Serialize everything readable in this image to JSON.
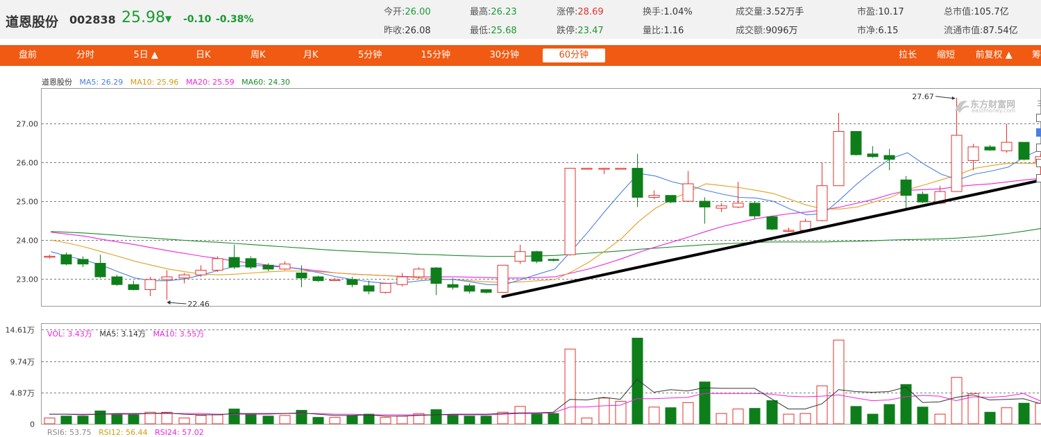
{
  "header": {
    "name": "道恩股份",
    "code": "002838",
    "price": "25.98",
    "arrow": "▼",
    "change": "-0.10",
    "change_pct": "-0.38%",
    "stats": [
      {
        "label": "今开:",
        "value": "26.00",
        "color": "green"
      },
      {
        "label": "最高:",
        "value": "26.23",
        "color": "green"
      },
      {
        "label": "涨停:",
        "value": "28.69",
        "color": "red"
      },
      {
        "label": "换手:",
        "value": "1.04%",
        "color": "plain"
      },
      {
        "label": "成交量:",
        "value": "3.52万手",
        "color": "plain"
      },
      {
        "label": "市盈:",
        "value": "10.17",
        "color": "plain"
      },
      {
        "label": "总市值:",
        "value": "105.7亿",
        "color": "plain"
      },
      {
        "label": "昨收:",
        "value": "26.08",
        "color": "plain"
      },
      {
        "label": "最低:",
        "value": "25.68",
        "color": "green"
      },
      {
        "label": "跌停:",
        "value": "23.47",
        "color": "green"
      },
      {
        "label": "量比:",
        "value": "1.16",
        "color": "plain"
      },
      {
        "label": "成交额:",
        "value": "9096万",
        "color": "plain"
      },
      {
        "label": "市净:",
        "value": "6.15",
        "color": "plain"
      },
      {
        "label": "流通市值:",
        "value": "87.54亿",
        "color": "plain"
      }
    ]
  },
  "nav": {
    "left": [
      "盘前",
      "分时",
      "5日 ▲",
      "日K",
      "周K",
      "月K",
      "5分钟",
      "15分钟",
      "30分钟",
      "60分钟"
    ],
    "active": "60分钟",
    "right": [
      "拉长",
      "缩短",
      "前复权 ▲",
      "筹"
    ]
  },
  "legend_main": {
    "name": "道恩股份",
    "ma5": "MA5: 26.29",
    "ma10": "MA10: 25.96",
    "ma20": "MA20: 25.59",
    "ma60": "MA60: 24.30"
  },
  "legend_vol": {
    "vol": "VOL: 3.43万",
    "ma5": "MA5: 3.14万",
    "ma10": "MA10: 3.55万"
  },
  "legend_rsi": {
    "rsi6": "RSI6: 53.75",
    "rsi12": "RSI12: 56.44",
    "rsi24": "RSI24: 57.02"
  },
  "annotations": {
    "high": "27.67",
    "low": "22.46"
  },
  "logo": {
    "cn": "东方财富网",
    "en": "eastmoney.com"
  },
  "colors": {
    "up": "#e5302a",
    "down": "#0e7e1a",
    "ma5": "#4a7fe0",
    "ma10": "#e0a020",
    "ma20": "#ee22dd",
    "ma60": "#1a8a2a",
    "accent": "#f05a12",
    "trend": "#000000"
  },
  "chart_data": [
    {
      "type": "candlestick",
      "title": "",
      "ylim": [
        22.3,
        27.9
      ],
      "yticks": [
        "23.00",
        "24.00",
        "25.00",
        "26.00",
        "27.00"
      ],
      "grid": true,
      "candles": [
        {
          "o": 23.58,
          "h": 23.62,
          "l": 23.52,
          "c": 23.58
        },
        {
          "o": 23.62,
          "h": 23.68,
          "l": 23.35,
          "c": 23.38
        },
        {
          "o": 23.5,
          "h": 23.58,
          "l": 23.3,
          "c": 23.38
        },
        {
          "o": 23.4,
          "h": 23.62,
          "l": 23.02,
          "c": 23.05
        },
        {
          "o": 23.05,
          "h": 23.1,
          "l": 22.82,
          "c": 22.85
        },
        {
          "o": 22.85,
          "h": 22.95,
          "l": 22.7,
          "c": 22.72
        },
        {
          "o": 22.72,
          "h": 23.05,
          "l": 22.55,
          "c": 22.98
        },
        {
          "o": 22.98,
          "h": 23.22,
          "l": 22.46,
          "c": 23.05
        },
        {
          "o": 23.02,
          "h": 23.15,
          "l": 22.88,
          "c": 23.1
        },
        {
          "o": 23.1,
          "h": 23.35,
          "l": 23.05,
          "c": 23.22
        },
        {
          "o": 23.22,
          "h": 23.58,
          "l": 23.18,
          "c": 23.52
        },
        {
          "o": 23.55,
          "h": 23.88,
          "l": 23.25,
          "c": 23.3
        },
        {
          "o": 23.52,
          "h": 23.58,
          "l": 23.25,
          "c": 23.3
        },
        {
          "o": 23.35,
          "h": 23.4,
          "l": 23.2,
          "c": 23.25
        },
        {
          "o": 23.25,
          "h": 23.45,
          "l": 23.22,
          "c": 23.38
        },
        {
          "o": 23.15,
          "h": 23.35,
          "l": 22.78,
          "c": 23.02
        },
        {
          "o": 23.05,
          "h": 23.08,
          "l": 22.92,
          "c": 22.95
        },
        {
          "o": 22.98,
          "h": 23.02,
          "l": 22.95,
          "c": 22.98
        },
        {
          "o": 22.98,
          "h": 23.05,
          "l": 22.78,
          "c": 22.85
        },
        {
          "o": 22.82,
          "h": 22.95,
          "l": 22.6,
          "c": 22.68
        },
        {
          "o": 22.65,
          "h": 22.9,
          "l": 22.62,
          "c": 22.88
        },
        {
          "o": 22.85,
          "h": 23.15,
          "l": 22.8,
          "c": 23.05
        },
        {
          "o": 23.05,
          "h": 23.3,
          "l": 23.0,
          "c": 23.25
        },
        {
          "o": 23.28,
          "h": 23.3,
          "l": 22.58,
          "c": 22.88
        },
        {
          "o": 22.85,
          "h": 23.02,
          "l": 22.72,
          "c": 22.78
        },
        {
          "o": 22.82,
          "h": 22.88,
          "l": 22.62,
          "c": 22.68
        },
        {
          "o": 22.72,
          "h": 22.72,
          "l": 22.62,
          "c": 22.65
        },
        {
          "o": 22.65,
          "h": 23.35,
          "l": 22.65,
          "c": 23.35
        },
        {
          "o": 23.45,
          "h": 23.88,
          "l": 23.38,
          "c": 23.7
        },
        {
          "o": 23.7,
          "h": 23.72,
          "l": 23.4,
          "c": 23.45
        },
        {
          "o": 23.5,
          "h": 23.52,
          "l": 23.45,
          "c": 23.48
        },
        {
          "o": 23.62,
          "h": 25.85,
          "l": 23.6,
          "c": 25.85
        },
        {
          "o": 25.85,
          "h": 25.85,
          "l": 25.85,
          "c": 25.85
        },
        {
          "o": 25.85,
          "h": 25.85,
          "l": 25.7,
          "c": 25.85
        },
        {
          "o": 25.85,
          "h": 25.85,
          "l": 25.85,
          "c": 25.85
        },
        {
          "o": 25.85,
          "h": 26.22,
          "l": 24.85,
          "c": 25.1
        },
        {
          "o": 25.1,
          "h": 25.28,
          "l": 25.05,
          "c": 25.15
        },
        {
          "o": 25.15,
          "h": 25.15,
          "l": 24.95,
          "c": 24.98
        },
        {
          "o": 25.0,
          "h": 25.78,
          "l": 24.98,
          "c": 25.45
        },
        {
          "o": 25.0,
          "h": 25.1,
          "l": 24.42,
          "c": 24.85
        },
        {
          "o": 24.82,
          "h": 24.95,
          "l": 24.72,
          "c": 24.88
        },
        {
          "o": 24.85,
          "h": 25.5,
          "l": 24.82,
          "c": 24.95
        },
        {
          "o": 24.95,
          "h": 24.98,
          "l": 24.55,
          "c": 24.62
        },
        {
          "o": 24.6,
          "h": 24.62,
          "l": 24.25,
          "c": 24.28
        },
        {
          "o": 24.25,
          "h": 24.32,
          "l": 24.2,
          "c": 24.25
        },
        {
          "o": 24.25,
          "h": 24.55,
          "l": 24.25,
          "c": 24.48
        },
        {
          "o": 24.5,
          "h": 26.0,
          "l": 24.48,
          "c": 25.4
        },
        {
          "o": 25.4,
          "h": 27.28,
          "l": 25.4,
          "c": 26.8
        },
        {
          "o": 26.8,
          "h": 26.8,
          "l": 26.18,
          "c": 26.2
        },
        {
          "o": 26.22,
          "h": 26.42,
          "l": 26.12,
          "c": 26.15
        },
        {
          "o": 26.18,
          "h": 26.35,
          "l": 25.8,
          "c": 26.08
        },
        {
          "o": 25.55,
          "h": 25.65,
          "l": 24.8,
          "c": 25.15
        },
        {
          "o": 25.18,
          "h": 25.25,
          "l": 24.95,
          "c": 24.98
        },
        {
          "o": 24.95,
          "h": 25.4,
          "l": 24.92,
          "c": 25.25
        },
        {
          "o": 25.25,
          "h": 27.67,
          "l": 25.25,
          "c": 26.7
        },
        {
          "o": 26.05,
          "h": 26.48,
          "l": 25.8,
          "c": 26.4
        },
        {
          "o": 26.4,
          "h": 26.45,
          "l": 26.3,
          "c": 26.32
        },
        {
          "o": 26.3,
          "h": 27.0,
          "l": 26.25,
          "c": 26.52
        },
        {
          "o": 26.52,
          "h": 26.52,
          "l": 26.05,
          "c": 26.08
        },
        {
          "o": 26.0,
          "h": 26.23,
          "l": 25.68,
          "c": 26.15
        }
      ],
      "ma5": [
        23.7,
        23.58,
        23.48,
        23.35,
        23.18,
        23.02,
        22.95,
        22.95,
        23.0,
        23.1,
        23.22,
        23.32,
        23.35,
        23.32,
        23.3,
        23.24,
        23.15,
        23.05,
        22.98,
        22.92,
        22.88,
        22.9,
        22.95,
        22.98,
        22.98,
        22.92,
        22.85,
        22.85,
        22.98,
        23.12,
        23.25,
        23.72,
        24.22,
        24.75,
        25.25,
        25.72,
        25.65,
        25.5,
        25.4,
        25.28,
        25.18,
        25.1,
        25.08,
        25.0,
        24.8,
        24.65,
        24.68,
        25.05,
        25.45,
        25.8,
        26.1,
        26.25,
        25.95,
        25.7,
        25.55,
        25.7,
        25.78,
        25.88,
        26.15,
        26.35
      ],
      "ma10": [
        24.0,
        23.92,
        23.82,
        23.7,
        23.58,
        23.45,
        23.35,
        23.25,
        23.18,
        23.12,
        23.1,
        23.12,
        23.15,
        23.18,
        23.2,
        23.2,
        23.18,
        23.15,
        23.12,
        23.1,
        23.08,
        23.05,
        23.02,
        23.0,
        22.98,
        22.95,
        22.92,
        22.9,
        22.92,
        22.95,
        22.98,
        23.18,
        23.42,
        23.72,
        24.05,
        24.48,
        24.82,
        25.05,
        25.25,
        25.45,
        25.4,
        25.35,
        25.28,
        25.2,
        25.05,
        24.9,
        24.8,
        24.8,
        24.85,
        24.98,
        25.1,
        25.3,
        25.42,
        25.55,
        25.68,
        25.85,
        25.92,
        25.98,
        25.98,
        25.96
      ],
      "ma20": [
        24.2,
        24.15,
        24.1,
        24.02,
        23.95,
        23.88,
        23.8,
        23.72,
        23.65,
        23.58,
        23.52,
        23.45,
        23.4,
        23.35,
        23.3,
        23.25,
        23.2,
        23.15,
        23.12,
        23.1,
        23.08,
        23.06,
        23.05,
        23.05,
        23.05,
        23.04,
        23.03,
        23.02,
        23.02,
        23.03,
        23.05,
        23.15,
        23.25,
        23.38,
        23.52,
        23.68,
        23.82,
        23.95,
        24.08,
        24.22,
        24.35,
        24.45,
        24.55,
        24.62,
        24.68,
        24.72,
        24.78,
        24.85,
        24.95,
        25.05,
        25.18,
        25.28,
        25.3,
        25.32,
        25.38,
        25.42,
        25.45,
        25.5,
        25.55,
        25.59
      ],
      "ma60": [
        24.22,
        24.2,
        24.18,
        24.15,
        24.12,
        24.08,
        24.05,
        24.02,
        23.99,
        23.96,
        23.94,
        23.91,
        23.88,
        23.85,
        23.82,
        23.79,
        23.76,
        23.73,
        23.71,
        23.69,
        23.67,
        23.65,
        23.63,
        23.62,
        23.6,
        23.59,
        23.58,
        23.58,
        23.58,
        23.59,
        23.6,
        23.63,
        23.66,
        23.69,
        23.72,
        23.76,
        23.79,
        23.82,
        23.85,
        23.88,
        23.9,
        23.92,
        23.94,
        23.95,
        23.95,
        23.95,
        23.95,
        23.96,
        23.97,
        23.98,
        24.0,
        24.01,
        24.02,
        24.03,
        24.05,
        24.08,
        24.12,
        24.17,
        24.23,
        24.3
      ],
      "trendline": [
        [
          27,
          22.54
        ],
        [
          61,
          25.55
        ]
      ]
    },
    {
      "type": "bar",
      "title": "",
      "ylim": [
        0,
        15.5
      ],
      "yticks": [
        "0",
        "4.87万",
        "9.74万",
        "14.61万"
      ],
      "grid": true,
      "values": [
        0.9,
        1.2,
        1.2,
        2.0,
        1.5,
        1.4,
        1.8,
        1.8,
        0.9,
        1.3,
        1.4,
        2.3,
        1.5,
        1.2,
        1.3,
        2.1,
        1.0,
        1.0,
        1.3,
        1.5,
        1.0,
        1.2,
        1.6,
        2.2,
        1.4,
        1.2,
        1.2,
        1.8,
        2.7,
        1.5,
        1.6,
        11.6,
        0.9,
        4.0,
        3.5,
        13.3,
        2.6,
        2.5,
        3.3,
        6.5,
        1.6,
        2.3,
        2.4,
        3.6,
        1.5,
        1.6,
        5.9,
        13.0,
        2.7,
        1.5,
        3.0,
        6.1,
        2.6,
        1.5,
        7.2,
        4.7,
        1.8,
        2.5,
        3.2,
        3.2
      ],
      "ma5": [
        1.5,
        1.5,
        1.4,
        1.5,
        1.6,
        1.6,
        1.6,
        1.7,
        1.5,
        1.4,
        1.4,
        1.6,
        1.6,
        1.6,
        1.6,
        1.7,
        1.5,
        1.3,
        1.3,
        1.4,
        1.2,
        1.2,
        1.3,
        1.4,
        1.5,
        1.5,
        1.5,
        1.6,
        1.7,
        1.7,
        1.8,
        3.8,
        3.7,
        4.1,
        3.8,
        6.9,
        4.9,
        5.3,
        5.1,
        5.6,
        5.5,
        5.5,
        5.5,
        3.9,
        2.3,
        2.3,
        3.1,
        5.3,
        5.0,
        4.9,
        5.0,
        5.7,
        3.3,
        3.4,
        4.1,
        4.5,
        3.7,
        3.8,
        3.9,
        3.14
      ],
      "ma10": [
        1.5,
        1.5,
        1.5,
        1.5,
        1.5,
        1.5,
        1.6,
        1.6,
        1.6,
        1.6,
        1.5,
        1.5,
        1.5,
        1.5,
        1.6,
        1.6,
        1.6,
        1.5,
        1.5,
        1.4,
        1.4,
        1.4,
        1.4,
        1.4,
        1.4,
        1.4,
        1.4,
        1.5,
        1.6,
        1.6,
        1.7,
        2.6,
        2.6,
        2.8,
        2.9,
        3.9,
        3.9,
        4.0,
        4.1,
        4.7,
        4.7,
        4.7,
        4.7,
        4.6,
        4.3,
        4.2,
        4.3,
        4.5,
        4.0,
        3.6,
        3.7,
        4.2,
        4.4,
        4.3,
        3.6,
        4.2,
        4.1,
        4.3,
        4.7,
        3.55
      ]
    }
  ]
}
